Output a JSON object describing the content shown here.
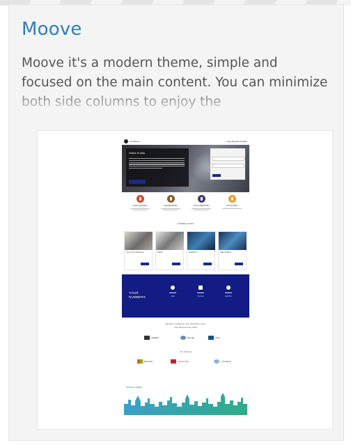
{
  "card": {
    "title": "Moove",
    "description": "Moove it's a modern theme, simple and focused on the main content. You can minimize both side columns to enjoy the"
  },
  "preview": {
    "site_brand": "moodlecom",
    "login_link": "Login  Register  English",
    "hero": {
      "title": "Sobre el sitio"
    },
    "features": [
      {
        "title": "CHALLENGES",
        "color": "#d7472a"
      },
      {
        "title": "LEADERSHIP",
        "color": "#8a5a2b"
      },
      {
        "title": "COLLABORATE",
        "color": "#3b3b6d"
      },
      {
        "title": "ACTIVITIES",
        "color": "#f19a2a"
      }
    ],
    "courses_title": "Available courses",
    "courses": [
      {
        "name": "Tips for the classroom"
      },
      {
        "name": "Writing"
      },
      {
        "name": "Algorithms"
      },
      {
        "name": "Data analytics"
      }
    ],
    "numbers_title_1": "YOUR",
    "numbers_title_2": "NUMBERS",
    "stats": [
      {
        "label": "users"
      },
      {
        "label": "courses"
      },
      {
        "label": "activities"
      }
    ],
    "partners_text_1": "Moodle is trusted by over 200 million users",
    "partners_text_2": "from all around the world",
    "partners_heading": "Our partners",
    "partner_logos_row1": [
      "SIERRA",
      "Moodle",
      "LMS"
    ],
    "partner_logos_row2": [
      "Microsoft",
      "Lemon corp",
      "Y Academy"
    ],
    "skyline_label": "MOOVE THEME"
  },
  "colors": {
    "title_blue": "#2c7fb8",
    "numbers_bg": "#121c84",
    "button_blue": "#1a2a8a",
    "skyline_green": "#2dad88"
  }
}
